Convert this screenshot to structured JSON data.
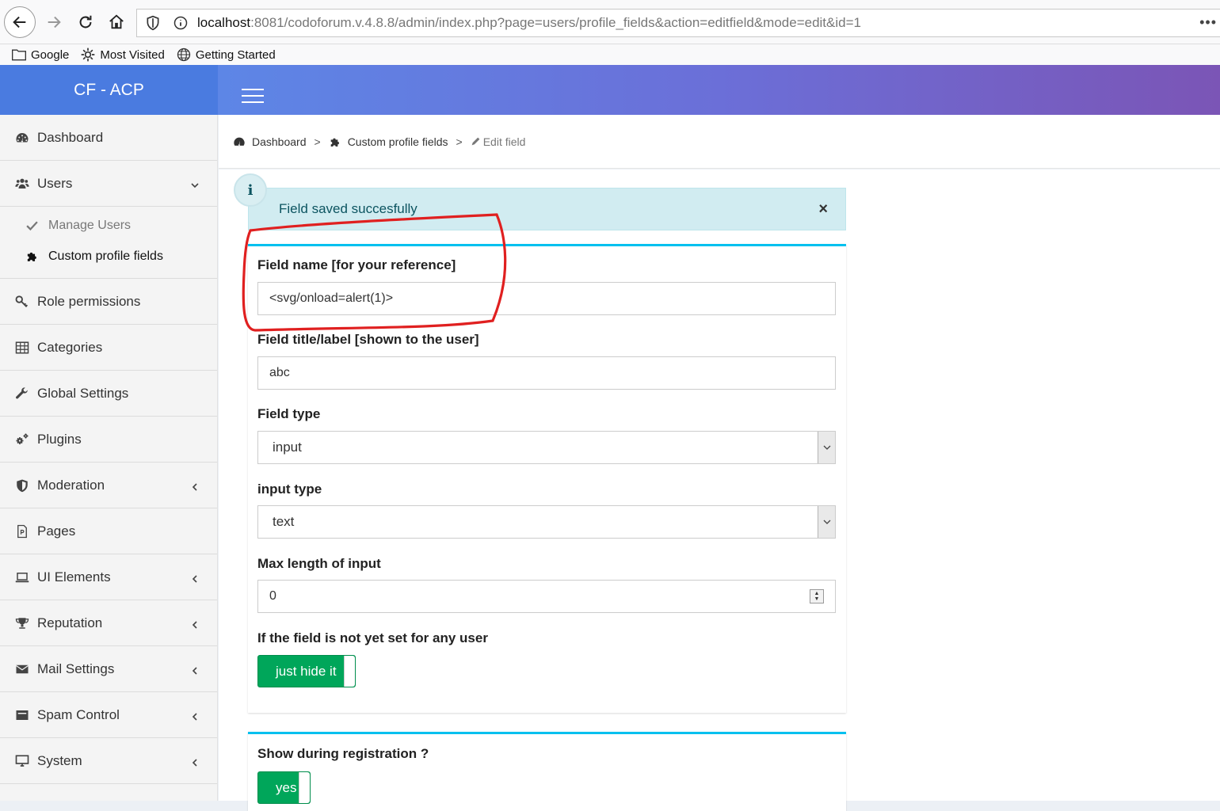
{
  "browser": {
    "url_host": "localhost",
    "url_rest": ":8081/codoforum.v.4.8.8/admin/index.php?page=users/profile_fields&action=editfield&mode=edit&id=1",
    "bookmarks": [
      {
        "label": "Google",
        "icon": "folder-icon"
      },
      {
        "label": "Most Visited",
        "icon": "gear-icon"
      },
      {
        "label": "Getting Started",
        "icon": "globe-icon"
      }
    ]
  },
  "header": {
    "brand": "CF - ACP"
  },
  "sidebar": {
    "items": [
      {
        "label": "Dashboard",
        "icon": "dashboard-icon"
      },
      {
        "label": "Users",
        "icon": "users-icon",
        "expanded": true
      },
      {
        "label": "Role permissions",
        "icon": "key-icon"
      },
      {
        "label": "Categories",
        "icon": "table-icon"
      },
      {
        "label": "Global Settings",
        "icon": "wrench-icon"
      },
      {
        "label": "Plugins",
        "icon": "cogs-icon"
      },
      {
        "label": "Moderation",
        "icon": "shield-icon"
      },
      {
        "label": "Pages",
        "icon": "file-icon"
      },
      {
        "label": "UI Elements",
        "icon": "laptop-icon"
      },
      {
        "label": "Reputation",
        "icon": "trophy-icon"
      },
      {
        "label": "Mail Settings",
        "icon": "envelope-icon"
      },
      {
        "label": "Spam Control",
        "icon": "inbox-icon"
      },
      {
        "label": "System",
        "icon": "desktop-icon"
      }
    ],
    "users_sub": [
      {
        "label": "Manage Users",
        "icon": "check-icon"
      },
      {
        "label": "Custom profile fields",
        "icon": "puzzle-icon"
      }
    ]
  },
  "breadcrumb": {
    "items": [
      "Dashboard",
      "Custom profile fields",
      "Edit field"
    ],
    "separator": ">"
  },
  "alert": {
    "message": "Field saved succesfully",
    "close": "×",
    "badge": "i"
  },
  "form": {
    "field_name_label": "Field name [for your reference]",
    "field_name_value": "<svg/onload=alert(1)>",
    "field_title_label": "Field title/label [shown to the user]",
    "field_title_value": "abc",
    "field_type_label": "Field type",
    "field_type_value": "input",
    "input_type_label": "input type",
    "input_type_value": "text",
    "max_length_label": "Max length of input",
    "max_length_value": "0",
    "not_set_label": "If the field is not yet set for any user",
    "not_set_toggle": "just hide it",
    "registration_label": "Show during registration ?",
    "registration_toggle": "yes"
  },
  "colors": {
    "brand": "#4a7be0",
    "toggle_on": "#00a65a",
    "card_border": "#00c0ef",
    "alert_bg": "#d1ecf1",
    "annotation": "#e02020"
  }
}
